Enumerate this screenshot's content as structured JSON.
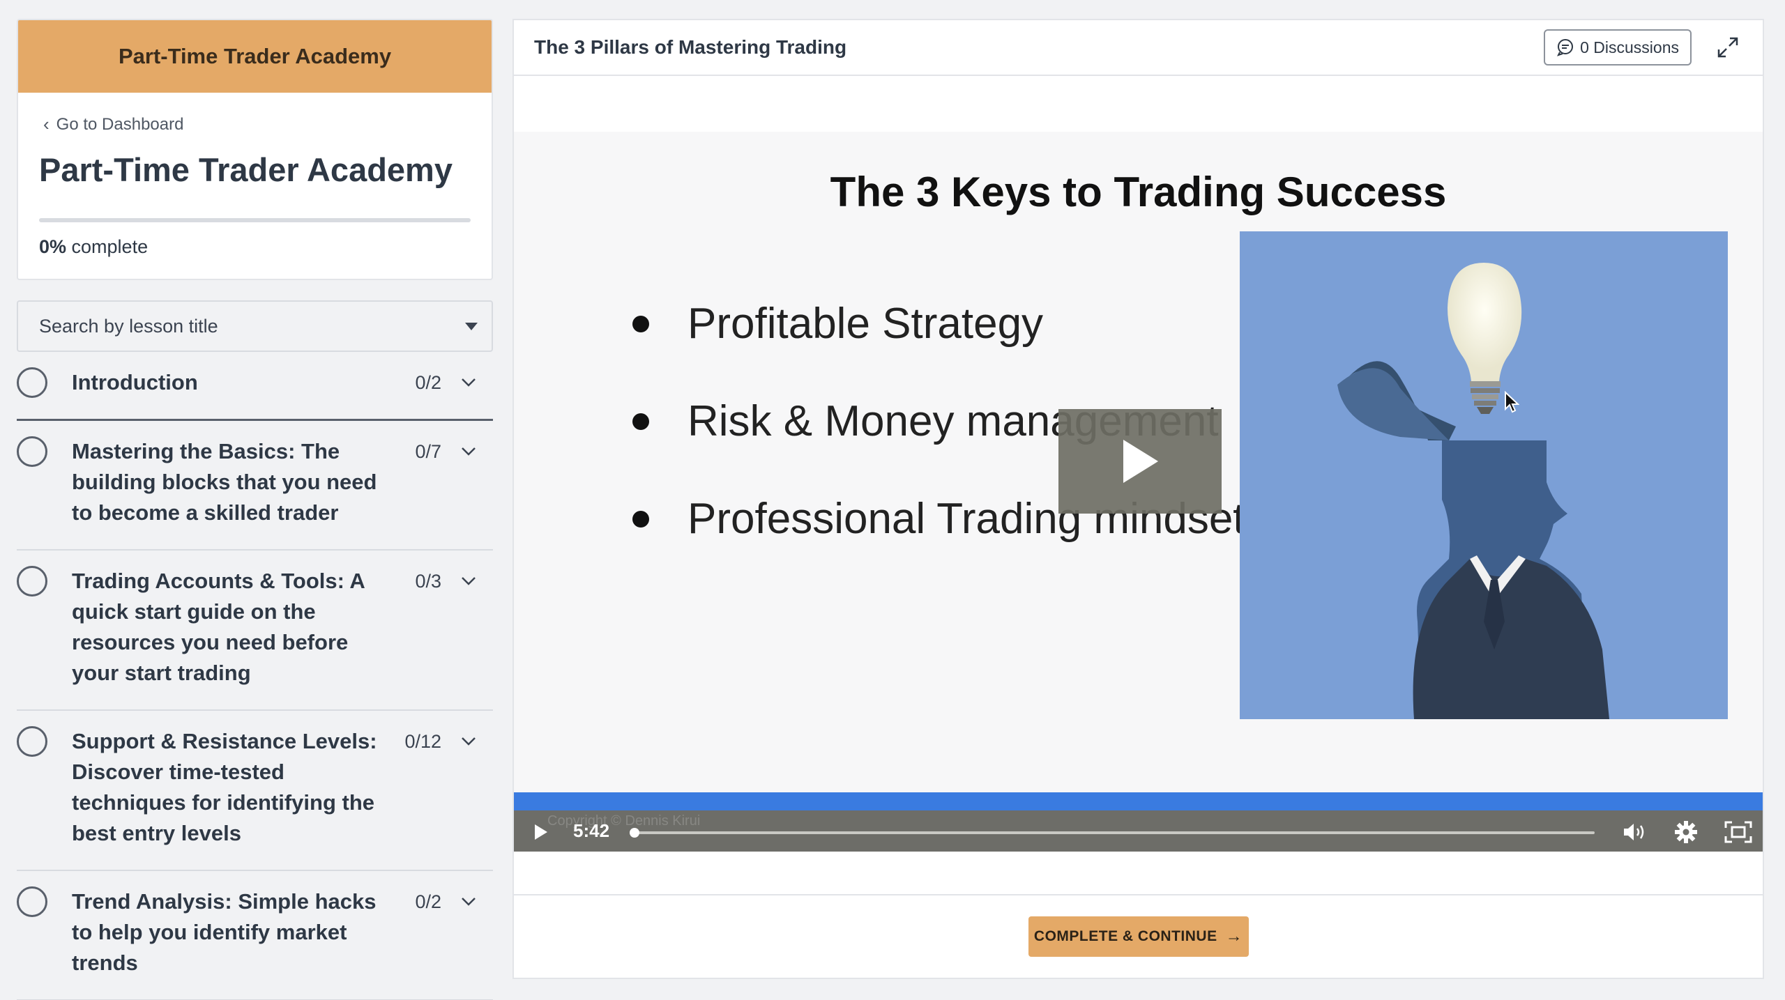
{
  "sidebar": {
    "course_header": "Part-Time Trader Academy",
    "back_link": "Go to Dashboard",
    "course_title": "Part-Time Trader Academy",
    "progress_percent": 0,
    "progress_value": "0%",
    "progress_suffix": " complete",
    "search_placeholder": "Search by lesson title",
    "chapters": [
      {
        "title": "Introduction",
        "count": "0/2"
      },
      {
        "title": "Mastering the Basics: The building blocks that you need to become a skilled trader",
        "count": "0/7"
      },
      {
        "title": "Trading Accounts & Tools: A quick start guide on the resources you need before your start trading",
        "count": "0/3"
      },
      {
        "title": "Support & Resistance Levels: Discover time-tested techniques for identifying the best entry levels",
        "count": "0/12"
      },
      {
        "title": "Trend Analysis: Simple hacks to help you identify market trends",
        "count": "0/2"
      }
    ]
  },
  "main": {
    "lesson_title": "The 3 Pillars of Mastering Trading",
    "discussions_label": "0 Discussions",
    "video": {
      "slide_title": "The 3 Keys to Trading Success",
      "bullets": [
        "Profitable Strategy",
        "Risk & Money management",
        "Professional Trading mindset"
      ],
      "watermark": "Copyright © Dennis Kirui",
      "time": "5:42",
      "progress_fraction": 0
    },
    "cta_label": "COMPLETE & CONTINUE",
    "cta_arrow": "→"
  },
  "colors": {
    "accent": "#e4a967",
    "video_progress": "#3a7be0",
    "image_bg": "#7b9fd6"
  },
  "icons": [
    "chevron-left-icon",
    "caret-down-icon",
    "circle-icon",
    "chevron-down-icon",
    "chat-bubble-icon",
    "expand-icon",
    "play-icon",
    "volume-icon",
    "settings-icon",
    "fullscreen-icon",
    "arrow-right-icon"
  ]
}
